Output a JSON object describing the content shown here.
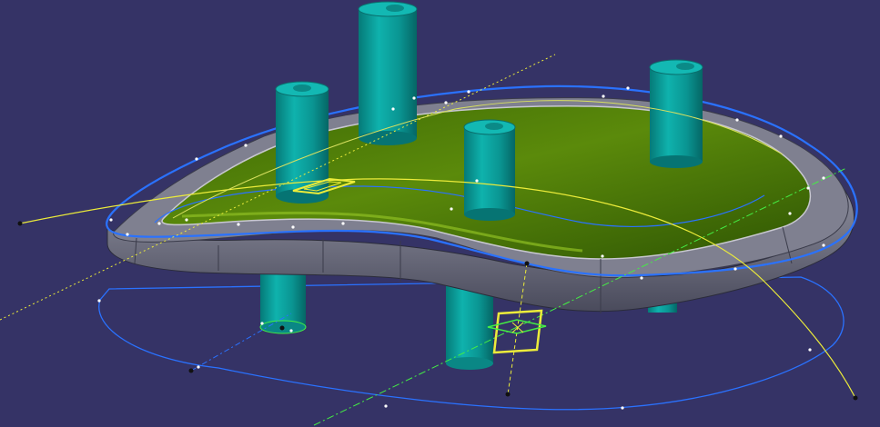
{
  "viewport": {
    "background": "#353366"
  },
  "colors": {
    "plate_top": "#4f7a08",
    "plate_top_highlight": "#6f9a14",
    "plate_side": "#5e5f70",
    "plate_rim": "#9a9ba6",
    "pin": "#0b9b99",
    "pin_dark": "#06706f",
    "pin_light": "#33c4c0",
    "blue_curve": "#2a72ff",
    "yellow_curve": "#ecec3a",
    "green_axis": "#44ee44",
    "point": "#ffffff"
  },
  "icons": {
    "compass_marker": "yellow-square-marker-icon",
    "plane_marker": "green-diamond-plane-icon",
    "axis_point": "black-dot-icon"
  }
}
